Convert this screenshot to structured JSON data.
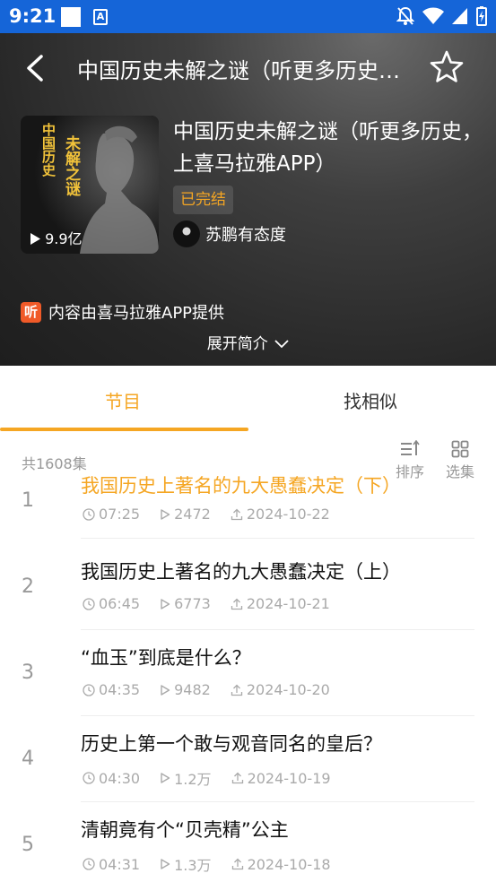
{
  "status_bar": {
    "time": "9:21",
    "app_icon": "A"
  },
  "header": {
    "title": "中国历史未解之谜（听更多历史…",
    "album_title": "中国历史未解之谜（听更多历史，上喜马拉雅APP）",
    "badge": "已完结",
    "author": "苏鹏有态度",
    "play_count": "9.9亿",
    "cover_text": [
      "中国历史",
      "未解之谜"
    ],
    "provider_icon": "听",
    "provider": "内容由喜马拉雅APP提供",
    "expand": "展开简介"
  },
  "tabs": [
    {
      "label": "节目",
      "active": true
    },
    {
      "label": "找相似",
      "active": false
    }
  ],
  "toolbar": {
    "count": "共1608集",
    "sort": "排序",
    "select": "选集"
  },
  "episodes": [
    {
      "num": "1",
      "title": "我国历史上著名的九大愚蠢决定（下）",
      "duration": "07:25",
      "plays": "2472",
      "date": "2024-10-22",
      "active": true
    },
    {
      "num": "2",
      "title": "我国历史上著名的九大愚蠢决定（上）",
      "duration": "06:45",
      "plays": "6773",
      "date": "2024-10-21"
    },
    {
      "num": "3",
      "title": "“血玉”到底是什么？",
      "duration": "04:35",
      "plays": "9482",
      "date": "2024-10-20"
    },
    {
      "num": "4",
      "title": "历史上第一个敢与观音同名的皇后？",
      "duration": "04:30",
      "plays": "1.2万",
      "date": "2024-10-19"
    },
    {
      "num": "5",
      "title": "清朝竟有个“贝壳精”公主",
      "duration": "04:31",
      "plays": "1.3万",
      "date": "2024-10-18"
    }
  ],
  "colors": {
    "accent": "#f5a623",
    "status_bar": "#1565d8",
    "provider_icon": "#f05a28"
  }
}
